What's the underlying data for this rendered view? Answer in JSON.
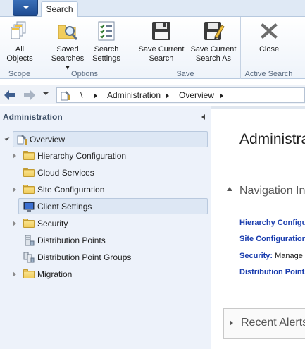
{
  "ribbon": {
    "tab_search": "Search",
    "groups": {
      "scope": "Scope",
      "options": "Options",
      "save": "Save",
      "active_search": "Active Search"
    },
    "buttons": {
      "all_objects": [
        "All",
        "Objects"
      ],
      "saved_searches": [
        "Saved",
        "Searches ▾"
      ],
      "search_settings": [
        "Search",
        "Settings"
      ],
      "save_current_search": [
        "Save Current",
        "Search"
      ],
      "save_current_search_as": [
        "Save Current",
        "Search As"
      ],
      "close": [
        "Close",
        ""
      ]
    }
  },
  "address": {
    "root": "\\",
    "crumbs": [
      "Administration",
      "Overview"
    ]
  },
  "left_pane": {
    "title": "Administration",
    "tree": [
      {
        "label": "Overview",
        "icon": "admin-overview-icon"
      },
      {
        "label": "Hierarchy Configuration",
        "icon": "folder-icon"
      },
      {
        "label": "Cloud Services",
        "icon": "folder-icon"
      },
      {
        "label": "Site Configuration",
        "icon": "folder-icon"
      },
      {
        "label": "Client Settings",
        "icon": "client-settings-icon"
      },
      {
        "label": "Security",
        "icon": "folder-icon"
      },
      {
        "label": "Distribution Points",
        "icon": "distribution-point-icon"
      },
      {
        "label": "Distribution Point Groups",
        "icon": "distribution-point-groups-icon"
      },
      {
        "label": "Migration",
        "icon": "folder-icon"
      }
    ]
  },
  "right_pane": {
    "title": "Administration",
    "section": "Navigation Index",
    "links": [
      {
        "label": "Hierarchy Configuration",
        "desc": ""
      },
      {
        "label": "Site Configuration",
        "desc": ""
      },
      {
        "label": "Security:",
        "desc": " Manage"
      },
      {
        "label": "Distribution Points",
        "desc": ""
      }
    ],
    "collapsed_section": "Recent Alerts"
  },
  "colors": {
    "link": "#1a3dae",
    "pane_bg": "#edf2fa",
    "folder": "#e8c35a"
  }
}
